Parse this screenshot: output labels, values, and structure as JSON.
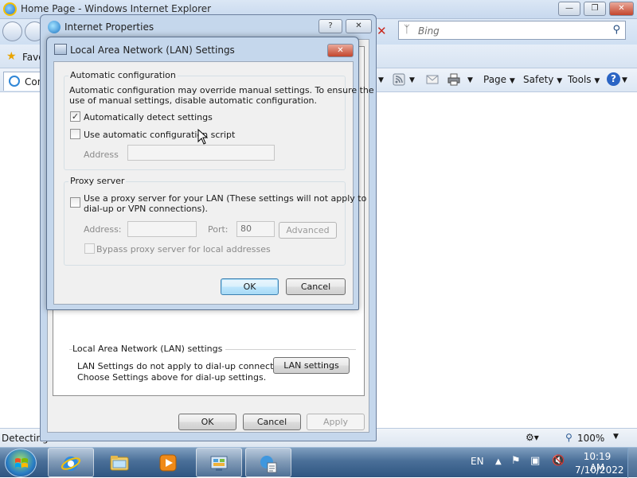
{
  "ie": {
    "title": "Home Page - Windows Internet Explorer",
    "search_placeholder": "Bing",
    "favorites_label": "Favo",
    "tab_label": "Con",
    "commands": {
      "page": "Page",
      "safety": "Safety",
      "tools": "Tools"
    },
    "status_text": "Detecting",
    "zoom": "100%"
  },
  "internet_properties": {
    "title": "Internet Properties",
    "lan_section_label": "Local Area Network (LAN) settings",
    "lan_desc_line1": "LAN Settings do not apply to dial-up connections.",
    "lan_desc_line2": "Choose Settings above for dial-up settings.",
    "lan_settings_button": "LAN settings",
    "ok": "OK",
    "cancel": "Cancel",
    "apply": "Apply"
  },
  "lan_dialog": {
    "title": "Local Area Network (LAN) Settings",
    "auto_config": {
      "label": "Automatic configuration",
      "desc_line1": "Automatic configuration may override manual settings.  To ensure the",
      "desc_line2": "use of manual settings, disable automatic configuration.",
      "auto_detect_label": "Automatically detect settings",
      "auto_detect_checked": true,
      "use_script_label": "Use automatic configuration script",
      "use_script_checked": false,
      "address_label": "Address",
      "address_value": ""
    },
    "proxy": {
      "label": "Proxy server",
      "use_proxy_line1": "Use a proxy server for your LAN (These settings will not apply to",
      "use_proxy_line2": "dial-up or VPN connections).",
      "use_proxy_checked": false,
      "address_label": "Address:",
      "address_value": "",
      "port_label": "Port:",
      "port_value": "80",
      "advanced_label": "Advanced",
      "bypass_label": "Bypass proxy server for local addresses",
      "bypass_checked": false
    },
    "ok": "OK",
    "cancel": "Cancel"
  },
  "taskbar": {
    "language": "EN",
    "time": "10:19 AM",
    "date": "7/10/2022"
  }
}
